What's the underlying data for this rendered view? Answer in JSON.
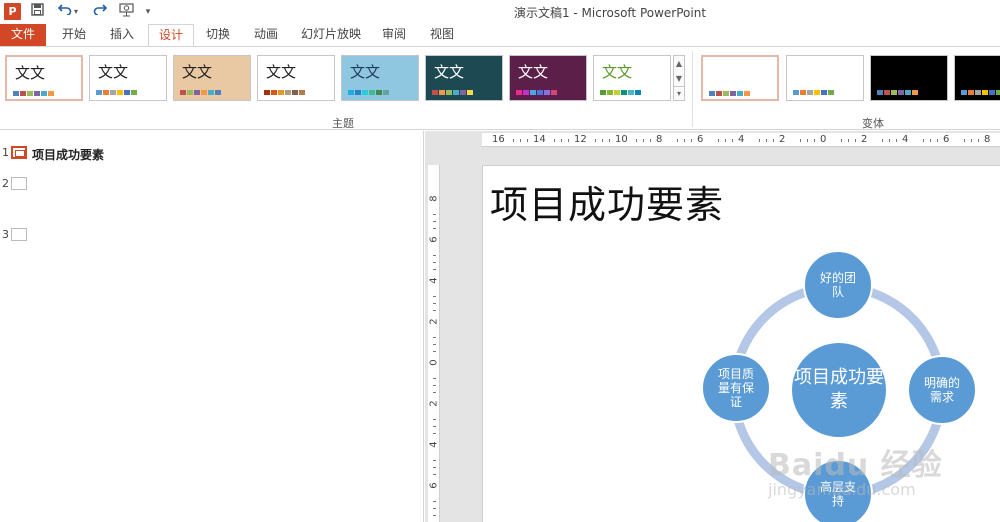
{
  "window_title": "演示文稿1 - Microsoft PowerPoint",
  "quick_access": {
    "logo": "P",
    "save_icon": "save-icon",
    "undo_icon": "undo-icon",
    "redo_icon": "redo-icon",
    "present_icon": "present-icon",
    "more_icon": "▾"
  },
  "tabs": [
    {
      "label": "文件"
    },
    {
      "label": "开始"
    },
    {
      "label": "插入"
    },
    {
      "label": "设计"
    },
    {
      "label": "切换"
    },
    {
      "label": "动画"
    },
    {
      "label": "幻灯片放映"
    },
    {
      "label": "审阅"
    },
    {
      "label": "视图"
    }
  ],
  "active_tab": "设计",
  "ribbon": {
    "themes_group_label": "主题",
    "variants_group_label": "变体",
    "theme_thumb_text": "文文",
    "themes": [
      {
        "label": "文文",
        "bg": "#ffffff",
        "text": "#222222",
        "bars": [
          "#4f81bd",
          "#c0504d",
          "#9bbb59",
          "#8064a2",
          "#4bacc6",
          "#f79646"
        ],
        "selected": true
      },
      {
        "label": "文文",
        "bg": "#ffffff",
        "text": "#222222",
        "bars": [
          "#5b9bd5",
          "#ed7d31",
          "#a5a5a5",
          "#ffc000",
          "#4472c4",
          "#70ad47"
        ]
      },
      {
        "label": "文文",
        "bg": "#e9c9a3",
        "text": "#222222",
        "bars": [
          "#c0504d",
          "#9bbb59",
          "#8064a2",
          "#f79646",
          "#4bacc6",
          "#4f81bd"
        ]
      },
      {
        "label": "文文",
        "bg": "#ffffff",
        "text": "#222222",
        "bars": [
          "#a5300f",
          "#d55816",
          "#e19825",
          "#b19c7d",
          "#7f5f52",
          "#b27d49"
        ]
      },
      {
        "label": "文文",
        "bg": "#8fc6e0",
        "text": "#1f3a5a",
        "bars": [
          "#1cade4",
          "#2683c6",
          "#27ced7",
          "#42ba97",
          "#3e8853",
          "#62a39f"
        ]
      },
      {
        "label": "文文",
        "bg": "#1d4a52",
        "text": "#ffffff",
        "bars": [
          "#c0504d",
          "#f79646",
          "#9bbb59",
          "#4bacc6",
          "#8064a2",
          "#f9d64a"
        ]
      },
      {
        "label": "文文",
        "bg": "#5c1f4a",
        "text": "#ffffff",
        "bars": [
          "#e32d91",
          "#c830cc",
          "#4ea6dc",
          "#4775e7",
          "#8971e1",
          "#d54773"
        ]
      },
      {
        "label": "文文",
        "bg": "#ffffff",
        "text": "#5a9a2a",
        "bars": [
          "#549e39",
          "#8ab833",
          "#c0cf3a",
          "#029676",
          "#4ab5c4",
          "#0989b1"
        ]
      }
    ],
    "variants": [
      {
        "bg": "#ffffff",
        "bars": [
          "#4f81bd",
          "#c0504d",
          "#9bbb59",
          "#8064a2",
          "#4bacc6",
          "#f79646"
        ],
        "selected": true
      },
      {
        "bg": "#ffffff",
        "bars": [
          "#5b9bd5",
          "#ed7d31",
          "#a5a5a5",
          "#ffc000",
          "#4472c4",
          "#70ad47"
        ]
      },
      {
        "bg": "#000000",
        "bars": [
          "#4f81bd",
          "#c0504d",
          "#9bbb59",
          "#8064a2",
          "#4bacc6",
          "#f79646"
        ]
      },
      {
        "bg": "#000000",
        "bars": [
          "#5b9bd5",
          "#ed7d31",
          "#a5a5a5",
          "#ffc000",
          "#4472c4",
          "#70ad47"
        ]
      }
    ]
  },
  "slides_pane": {
    "slides": [
      {
        "number": "1",
        "title": "项目成功要素",
        "active": true
      },
      {
        "number": "2",
        "title": ""
      },
      {
        "number": "3",
        "title": ""
      }
    ]
  },
  "rulers": {
    "horizontal_labels": [
      "16",
      "14",
      "12",
      "10",
      "8",
      "6",
      "4",
      "2",
      "0",
      "2",
      "4",
      "6",
      "8"
    ],
    "vertical_labels": [
      "8",
      "6",
      "4",
      "2",
      "0",
      "2",
      "4",
      "6"
    ]
  },
  "slide": {
    "title": "项目成功要素",
    "diagram": {
      "center": "项目成功要素",
      "nodes": [
        {
          "text": "好的团队"
        },
        {
          "text": "明确的需求"
        },
        {
          "text": "高层支持"
        },
        {
          "text": "项目质量有保证"
        }
      ],
      "node_color": "#5b9bd5",
      "ring_color": "#b4c7e7"
    }
  },
  "watermark": {
    "text": "Baidu 经验",
    "url": "jingyan.baidu.com"
  },
  "colors": {
    "accent": "#d24726"
  }
}
